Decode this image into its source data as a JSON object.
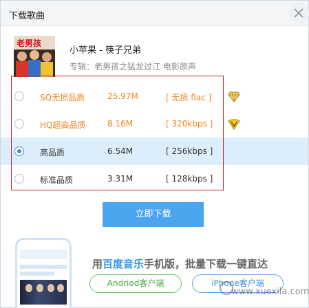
{
  "dialog": {
    "title": "下载歌曲"
  },
  "song": {
    "title": "小苹果 - 筷子兄弟",
    "album": "专辑：老男孩之猛龙过江 电影原声",
    "cover_text": "老男孩"
  },
  "qualities": [
    {
      "name": "SQ无损品质",
      "size": "25.97M",
      "format": "[ 无损 flac ]",
      "selected": false,
      "badge": "diamond-vip-icon"
    },
    {
      "name": "HQ超高品质",
      "size": "8.16M",
      "format": "[ 320kbps ]",
      "selected": false,
      "badge": "v-vip-icon"
    },
    {
      "name": "高品质",
      "size": "6.54M",
      "format": "[ 256kbps ]",
      "selected": true,
      "badge": ""
    },
    {
      "name": "标准品质",
      "size": "3.31M",
      "format": "[ 128kbps ]",
      "selected": false,
      "badge": ""
    }
  ],
  "actions": {
    "download_label": "立即下载"
  },
  "promo": {
    "prefix": "用",
    "highlight": "百度音乐",
    "suffix": "手机版，批量下载一键直达",
    "android_label": "Andriod客户端",
    "iphone_label": "iPhone客户端"
  },
  "watermark": {
    "text": "www.xuexila.com"
  },
  "colors": {
    "accent_blue": "#4aa5ee",
    "orange": "#f0841f",
    "selected_row": "#dceefc",
    "highlight_box": "#c22428",
    "green": "#6dc468"
  }
}
